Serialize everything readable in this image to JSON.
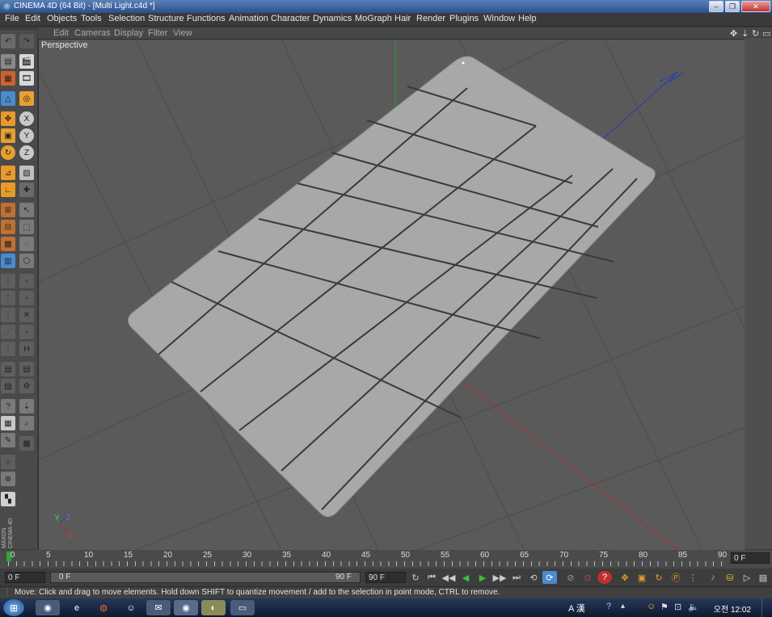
{
  "window": {
    "title": "CINEMA 4D (64 Bit) - [Multi Light.c4d *]"
  },
  "menubar": [
    "File",
    "Edit",
    "Objects",
    "Tools",
    "Selection",
    "Structure",
    "Functions",
    "Animation",
    "Character",
    "Dynamics",
    "MoGraph",
    "Hair",
    "Render",
    "Plugins",
    "Window",
    "Help"
  ],
  "viewport": {
    "menus": [
      "Edit",
      "Cameras",
      "Display",
      "Filter",
      "View"
    ],
    "label": "Perspective",
    "axis_labels": {
      "y": "Y",
      "z": "Z",
      "x": "X"
    }
  },
  "timeline": {
    "ticks": [
      "0",
      "5",
      "10",
      "15",
      "20",
      "25",
      "30",
      "35",
      "40",
      "45",
      "50",
      "55",
      "60",
      "65",
      "70",
      "75",
      "80",
      "85",
      "90"
    ],
    "current_frame": "0 F"
  },
  "transport": {
    "start_field": "0 F",
    "range_start": "0 F",
    "range_end": "90 F",
    "end_field": "90 F"
  },
  "status": {
    "message": "Move: Click and drag to move elements. Hold down SHIFT to quantize movement / add to the selection in point mode, CTRL to remove."
  },
  "brand": {
    "maxon": "MAXON",
    "product": "CINEMA 4D"
  },
  "taskbar": {
    "tray_lang": "A 漢",
    "clock": "오전 12:02"
  },
  "colors": {
    "accent_active": "#e89a2a",
    "axis_x": "#b03030",
    "axis_y": "#30a030",
    "axis_z": "#3040b0",
    "plane": "#a8a8a8"
  }
}
